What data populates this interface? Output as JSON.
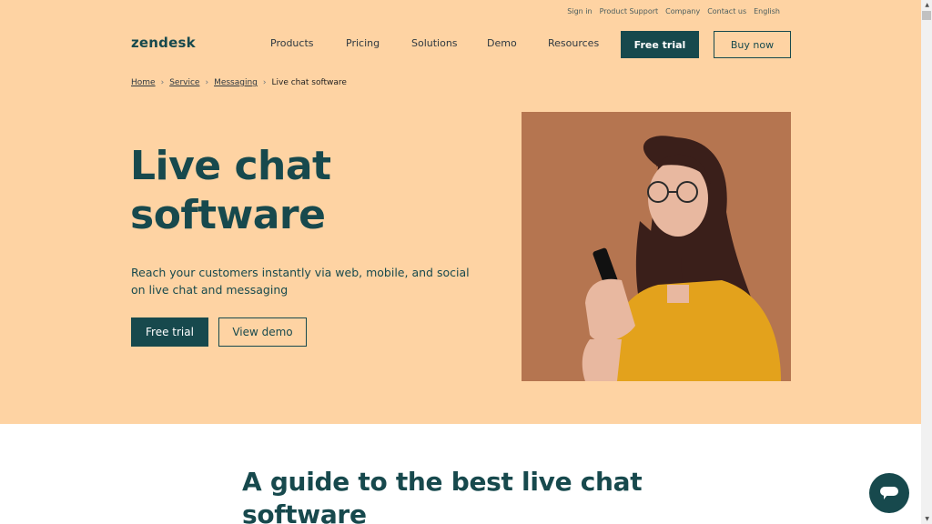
{
  "utility_nav": [
    "Sign in",
    "Product Support",
    "Company",
    "Contact us",
    "English"
  ],
  "logo": "zendesk",
  "nav": {
    "items": [
      "Products",
      "Pricing",
      "Solutions",
      "Demo",
      "Resources"
    ],
    "free_trial": "Free trial",
    "buy_now": "Buy now"
  },
  "breadcrumb": {
    "links": [
      "Home",
      "Service",
      "Messaging"
    ],
    "current": "Live chat software"
  },
  "hero": {
    "title_line1": "Live chat",
    "title_line2": "software",
    "subtitle": "Reach your customers instantly via web, mobile, and social on live chat and messaging",
    "primary_cta": "Free trial",
    "secondary_cta": "View demo",
    "image_alt": "Woman with glasses in yellow shirt looking at her phone"
  },
  "guide": {
    "heading_line1": "A guide to the best live chat",
    "heading_line2": "software"
  },
  "colors": {
    "hero_bg": "#fed3a3",
    "brand": "#17494d"
  }
}
